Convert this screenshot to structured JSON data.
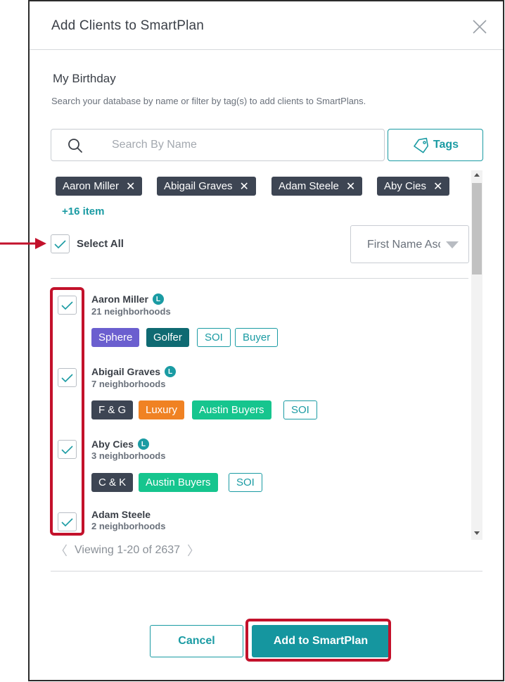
{
  "modal": {
    "title": "Add Clients to SmartPlan",
    "section_title": "My Birthday",
    "description": "Search your database by name or filter by tag(s) to add clients to SmartPlans."
  },
  "search": {
    "placeholder": "Search By Name",
    "value": ""
  },
  "tags_button": {
    "label": "Tags"
  },
  "selected_chips": [
    {
      "label": "Aaron Miller"
    },
    {
      "label": "Abigail Graves"
    },
    {
      "label": "Adam Steele"
    },
    {
      "label": "Aby Cies"
    }
  ],
  "more_items": "+16 item",
  "select_all": {
    "label": "Select All",
    "checked": true
  },
  "sort": {
    "selected": "First Name Ascending"
  },
  "clients": [
    {
      "name": "Aaron Miller",
      "badge": "L",
      "subtitle": "21 neighborhoods",
      "tags": [
        {
          "label": "Sphere",
          "color": "#6b5fcf",
          "style": "filled"
        },
        {
          "label": "Golfer",
          "color": "#0f6a72",
          "style": "filled"
        },
        {
          "label": "SOI",
          "color": "#1a9ba3",
          "style": "outline"
        },
        {
          "label": "Buyer",
          "color": "#1a9ba3",
          "style": "outline"
        }
      ]
    },
    {
      "name": "Abigail Graves",
      "badge": "L",
      "subtitle": "7 neighborhoods",
      "tags": [
        {
          "label": "F & G",
          "color": "#3d4553",
          "style": "filled"
        },
        {
          "label": "Luxury",
          "color": "#f08223",
          "style": "filled"
        },
        {
          "label": "Austin Buyers",
          "color": "#16c58e",
          "style": "filled"
        },
        {
          "label": "SOI",
          "color": "#1a9ba3",
          "style": "outline"
        }
      ]
    },
    {
      "name": "Aby Cies",
      "badge": "L",
      "subtitle": "3 neighborhoods",
      "tags": [
        {
          "label": "C & K",
          "color": "#3d4553",
          "style": "filled"
        },
        {
          "label": "Austin Buyers",
          "color": "#16c58e",
          "style": "filled"
        },
        {
          "label": "SOI",
          "color": "#1a9ba3",
          "style": "outline"
        }
      ]
    },
    {
      "name": "Adam Steele",
      "badge": "",
      "subtitle": "2 neighborhoods",
      "tags": []
    }
  ],
  "pagination": {
    "text": "Viewing 1-20 of 2637",
    "prev": "〈",
    "next": "〉"
  },
  "buttons": {
    "cancel": "Cancel",
    "add": "Add to SmartPlan"
  },
  "colors": {
    "accent": "#1a9ba3",
    "highlight": "#c3112b",
    "chip": "#3d4553"
  }
}
